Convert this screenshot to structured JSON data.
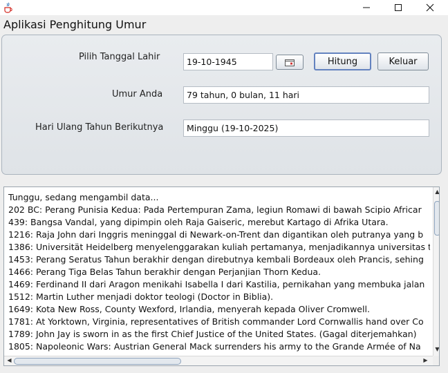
{
  "window": {
    "icon": "java-cup-icon",
    "controls": {
      "minimize": "minimize-icon",
      "maximize": "maximize-icon",
      "close": "close-icon"
    }
  },
  "app": {
    "title": "Aplikasi Penghitung Umur"
  },
  "form": {
    "birth_label": "Pilih Tanggal Lahir",
    "birth_value": "19-10-1945",
    "calendar_icon": "calendar-icon",
    "calculate_label": "Hitung",
    "exit_label": "Keluar",
    "age_label": "Umur Anda",
    "age_value": "79 tahun, 0 bulan, 11 hari",
    "next_birthday_label": "Hari Ulang Tahun Berikutnya",
    "next_birthday_value": "Minggu (19-10-2025)"
  },
  "log": {
    "lines": [
      "Tunggu, sedang mengambil data...",
      "202 BC: Perang Punisia Kedua: Pada Pertempuran Zama, legiun Romawi di bawah Scipio Africar",
      "439: Bangsa Vandal, yang dipimpin oleh Raja Gaiseric, merebut Kartago di Afrika Utara.",
      "1216: Raja John dari Inggris meninggal di Newark-on-Trent dan digantikan oleh putranya yang b",
      "1386: Universität Heidelberg menyelenggarakan kuliah pertamanya, menjadikannya universitas t",
      "1453: Perang Seratus Tahun berakhir dengan direbutnya kembali Bordeaux oleh Prancis, sehing",
      "1466: Perang Tiga Belas Tahun berakhir dengan Perjanjian Thorn Kedua.",
      "1469: Ferdinand II dari Aragon menikahi Isabella I dari Kastilia, pernikahan yang membuka jalan",
      "1512: Martin Luther menjadi doktor teologi (Doctor in Biblia).",
      "1649: Kota New Ross, County Wexford, Irlandia, menyerah kepada Oliver Cromwell.",
      "1781: At Yorktown, Virginia, representatives of British commander Lord Cornwallis hand over Co",
      "1789: John Jay is sworn in as the first Chief Justice of the United States. (Gagal diterjemahkan)",
      "1805: Napoleonic Wars: Austrian General Mack surrenders his army to the Grande Armée of Na"
    ]
  }
}
